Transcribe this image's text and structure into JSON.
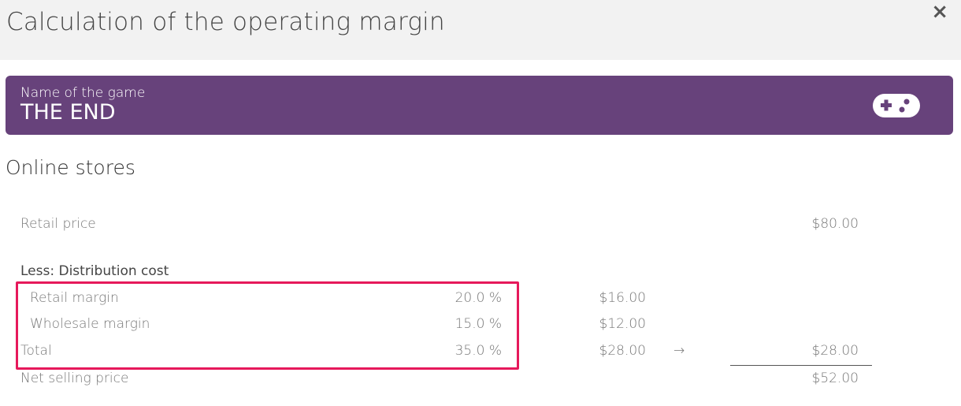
{
  "dialog": {
    "title": "Calculation of the operating margin",
    "close_label": "×"
  },
  "game": {
    "label": "Name of the game",
    "name": "THE END",
    "icon": "gamepad-icon"
  },
  "section": {
    "title": "Online stores"
  },
  "table": {
    "retail_price": {
      "label": "Retail price",
      "total": "$80.00"
    },
    "distribution_heading": "Less: Distribution cost",
    "retail_margin": {
      "label": "Retail margin",
      "percent": "20.0 %",
      "amount": "$16.00"
    },
    "wholesale_margin": {
      "label": "Wholesale margin",
      "percent": "15.0 %",
      "amount": "$12.00"
    },
    "total": {
      "label": "Total",
      "percent": "35.0 %",
      "amount": "$28.00",
      "arrow": "→",
      "total": "$28.00"
    },
    "net_selling_price": {
      "label": "Net selling price",
      "total": "$52.00"
    }
  },
  "colors": {
    "banner": "#67427b",
    "highlight": "#e6195b",
    "header_bg": "#f2f2f2"
  }
}
